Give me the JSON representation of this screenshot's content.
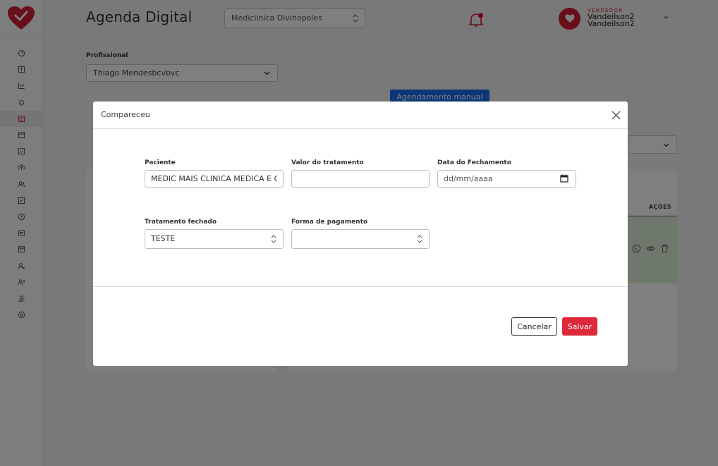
{
  "app": {
    "title": "Agenda Digital",
    "clinic": "Mediclinica Divinopoles",
    "user_role": "VENDEDOR",
    "user_name": "Vandeilson2 Vandeilson2",
    "brand_color": "#d01f32",
    "sidebar_icons": [
      "dashboard-icon",
      "finance-icon",
      "chart-icon",
      "notification-icon",
      "calendar-icon",
      "schedule-icon",
      "calendar-check-icon",
      "upload-icon",
      "users-icon",
      "checklist-icon",
      "clock-icon",
      "card-icon",
      "calendar-list-icon",
      "user-add-icon",
      "user-group-icon",
      "money-icon",
      "settings-icon"
    ]
  },
  "filters": {
    "profissional_label": "Profissional",
    "profissional_value": "Thiago Mendesbcvbvc",
    "manual_button": "Agendamento manual"
  },
  "table": {
    "acoes_header": "AÇÕES",
    "row_actions": [
      "whatsapp-icon",
      "eye-icon",
      "trash-icon"
    ]
  },
  "modal": {
    "title": "Compareceu",
    "fields": {
      "paciente_label": "Paciente",
      "paciente_value": "MEDIC MAIS CLINICA MEDICA E C",
      "valor_label": "Valor do tratamento",
      "valor_value": "",
      "data_label": "Data do Fechamento",
      "data_placeholder": "dd/mm/aaaa",
      "tratamento_label": "Tratamento fechado",
      "tratamento_value": "TESTE",
      "pagamento_label": "Forma de pagamento",
      "pagamento_value": ""
    },
    "cancel_label": "Cancelar",
    "save_label": "Salvar",
    "save_color": "#dc2a3c"
  }
}
